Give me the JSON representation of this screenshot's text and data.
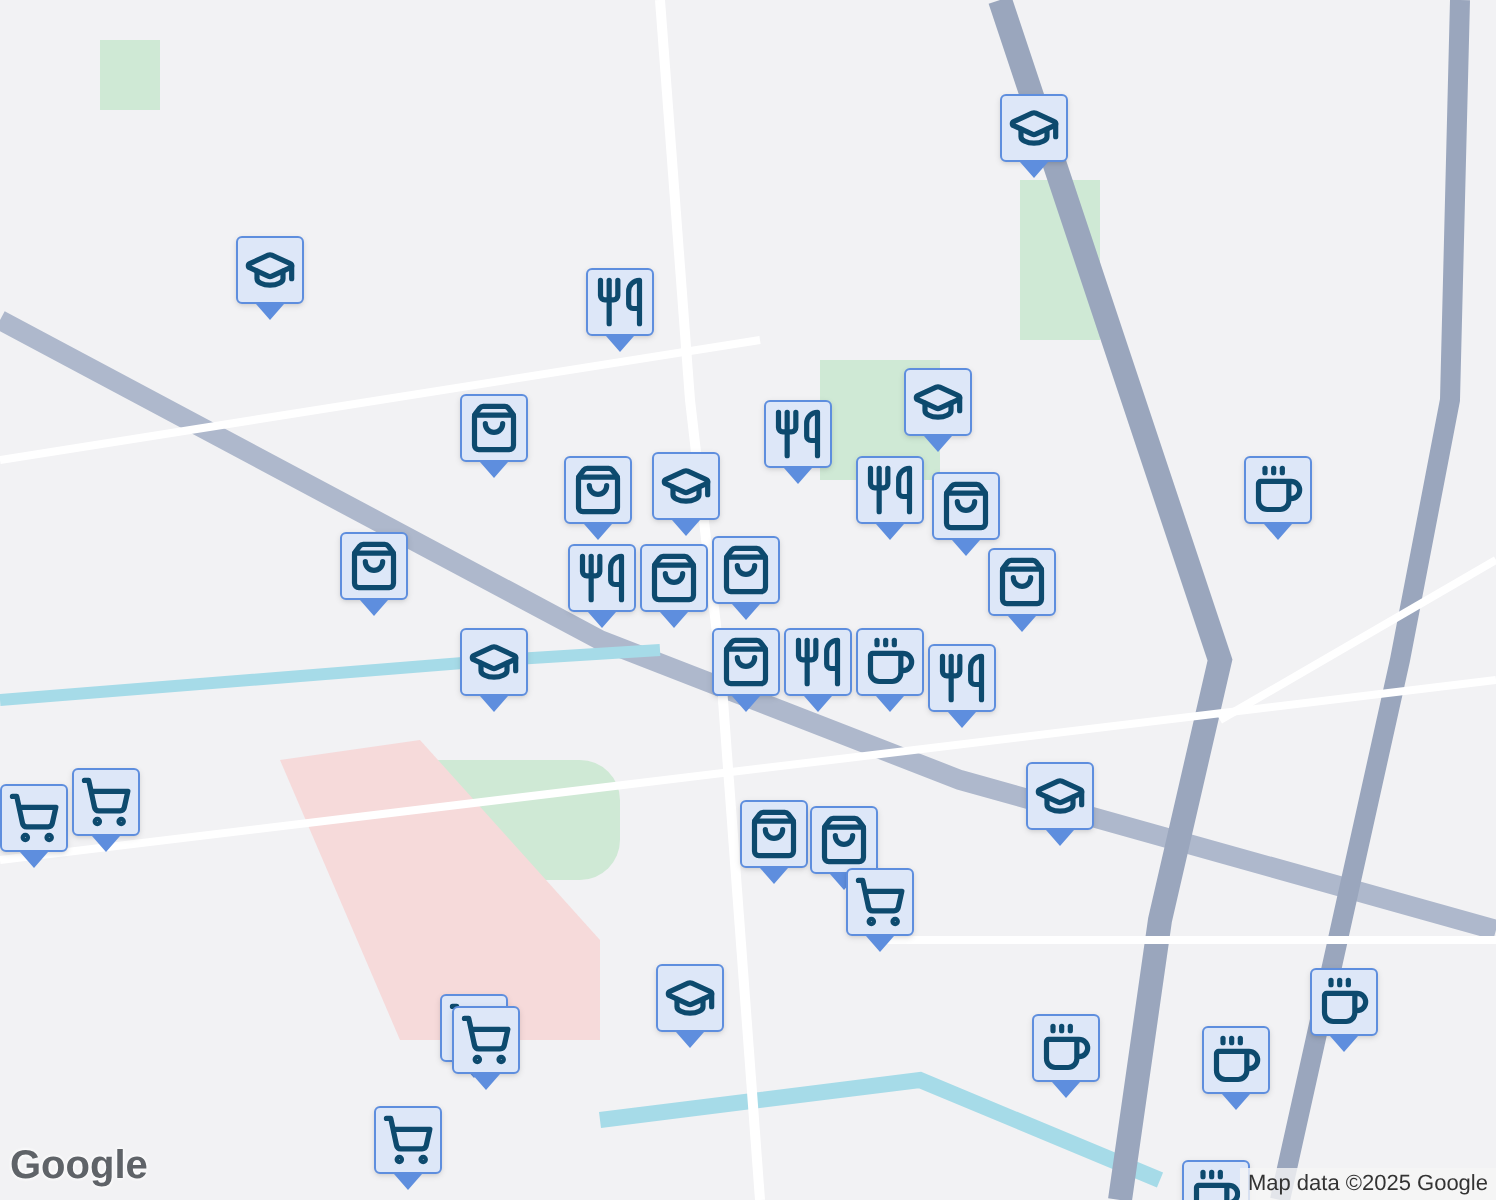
{
  "map": {
    "markers": [
      {
        "kind": "school"
      },
      {
        "kind": "school"
      },
      {
        "kind": "food"
      },
      {
        "kind": "shop"
      },
      {
        "kind": "food"
      },
      {
        "kind": "school"
      },
      {
        "kind": "food"
      },
      {
        "kind": "shop"
      },
      {
        "kind": "cafe"
      },
      {
        "kind": "shop"
      },
      {
        "kind": "shop"
      },
      {
        "kind": "school"
      },
      {
        "kind": "food"
      },
      {
        "kind": "shop"
      },
      {
        "kind": "shop"
      },
      {
        "kind": "shop"
      },
      {
        "kind": "food"
      },
      {
        "kind": "cafe"
      },
      {
        "kind": "food"
      },
      {
        "kind": "shop"
      },
      {
        "kind": "school"
      },
      {
        "kind": "school"
      },
      {
        "kind": "shop"
      },
      {
        "kind": "shop"
      },
      {
        "kind": "cart"
      },
      {
        "kind": "cart"
      },
      {
        "kind": "cart"
      },
      {
        "kind": "cart"
      },
      {
        "kind": "cart"
      },
      {
        "kind": "school"
      },
      {
        "kind": "cart"
      },
      {
        "kind": "cafe"
      },
      {
        "kind": "cafe"
      },
      {
        "kind": "cafe"
      },
      {
        "kind": "cafe"
      }
    ]
  },
  "logo": "Google",
  "attribution": "Map data ©2025 Google"
}
